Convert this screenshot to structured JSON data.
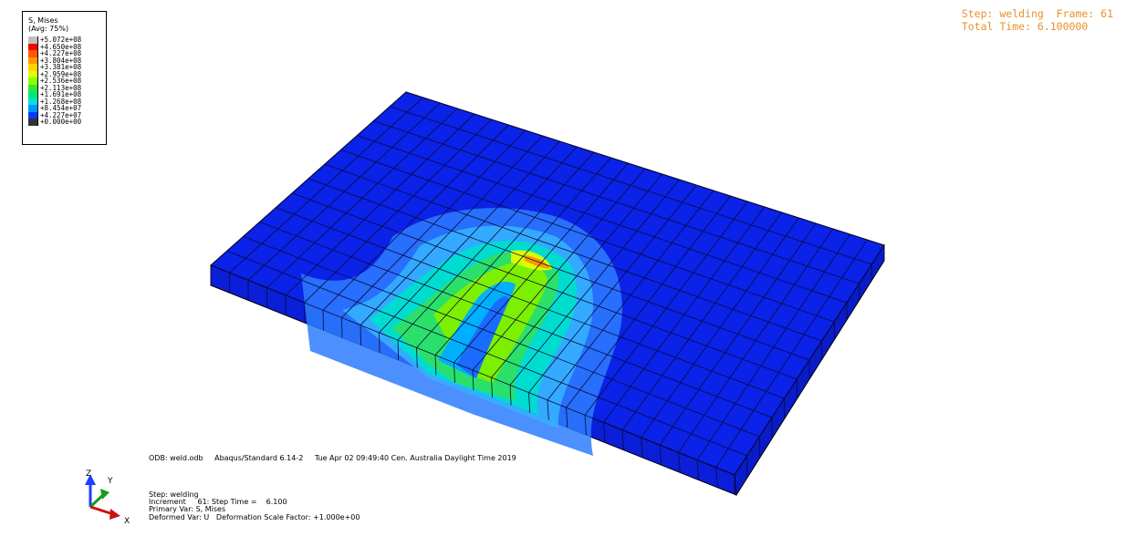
{
  "legend": {
    "title": "S, Mises",
    "averaging": "(Avg: 75%)",
    "entries": [
      {
        "value": "+5.072e+08",
        "color": "#c0c0c0"
      },
      {
        "value": "+4.650e+08",
        "color": "#ff0000"
      },
      {
        "value": "+4.227e+08",
        "color": "#ff5a00"
      },
      {
        "value": "+3.804e+08",
        "color": "#ff9900"
      },
      {
        "value": "+3.381e+08",
        "color": "#ffd400"
      },
      {
        "value": "+2.959e+08",
        "color": "#e0ff00"
      },
      {
        "value": "+2.536e+08",
        "color": "#8cff00"
      },
      {
        "value": "+2.113e+08",
        "color": "#2eea2e"
      },
      {
        "value": "+1.691e+08",
        "color": "#00e67a"
      },
      {
        "value": "+1.268e+08",
        "color": "#00e0e0"
      },
      {
        "value": "+8.454e+07",
        "color": "#0096ff"
      },
      {
        "value": "+4.227e+07",
        "color": "#003cff"
      },
      {
        "value": "+0.000e+00",
        "color": "#333333"
      }
    ]
  },
  "step_info": {
    "line1": "Step: welding  Frame: 61",
    "line2": "Total Time: 6.100000"
  },
  "odb_info": {
    "odb": "ODB: weld.odb",
    "solver": "Abaqus/Standard 6.14-2",
    "date": "Tue Apr 02 09:49:40 Cen. Australia Daylight Time 2019"
  },
  "status": {
    "step": "Step: welding",
    "increment": "Increment     61: Step Time =    6.100",
    "primary_var": "Primary Var: S, Mises",
    "deformed_var": "Deformed Var: U   Deformation Scale Factor: +1.000e+00"
  },
  "triad": {
    "z_label": "Z",
    "y_label": "Y",
    "x_label": "X"
  },
  "colors": {
    "plate": "#0a1ee6",
    "side": "#0a1ad2",
    "grid": "#0a0a40",
    "step_text": "#e8922b"
  }
}
